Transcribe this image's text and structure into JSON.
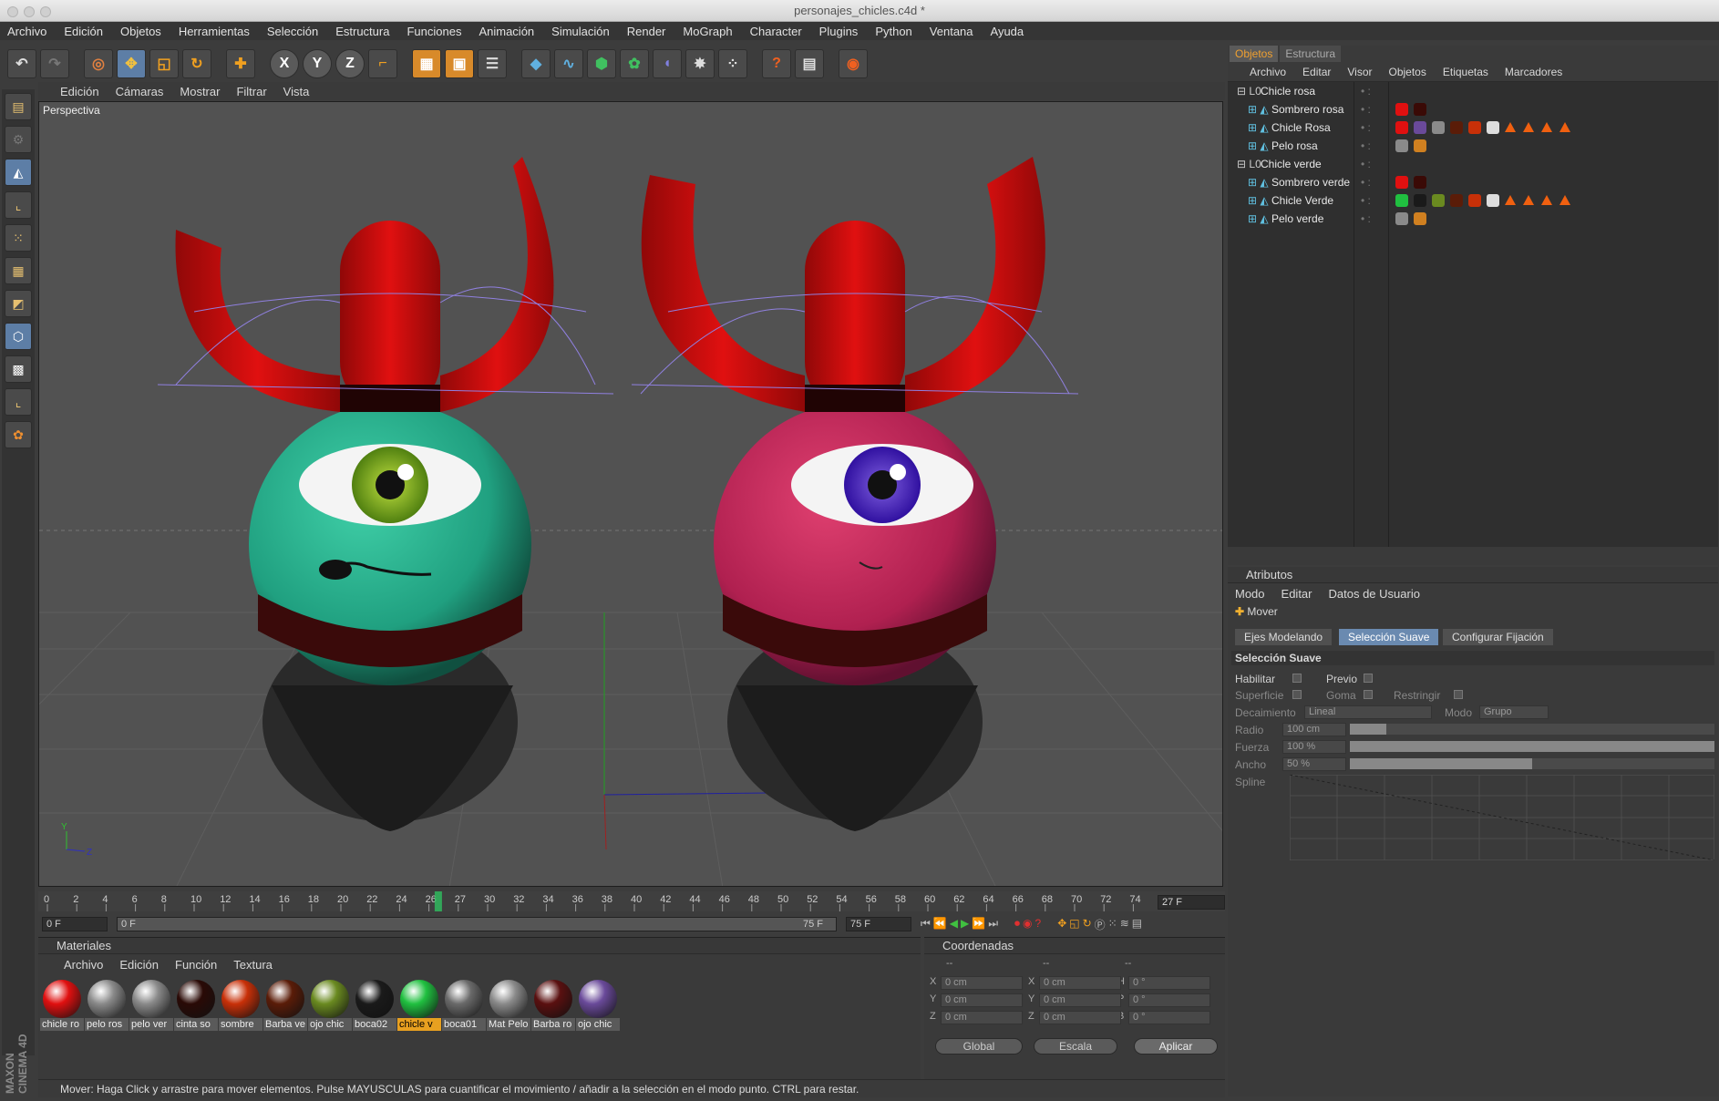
{
  "window": {
    "title": "personajes_chicles.c4d *"
  },
  "menu": [
    "Archivo",
    "Edición",
    "Objetos",
    "Herramientas",
    "Selección",
    "Estructura",
    "Funciones",
    "Animación",
    "Simulación",
    "Render",
    "MoGraph",
    "Character",
    "Plugins",
    "Python",
    "Ventana",
    "Ayuda"
  ],
  "toolbar": {
    "x_label": "X",
    "y_label": "Y",
    "z_label": "Z"
  },
  "viewport": {
    "menu": [
      "Edición",
      "Cámaras",
      "Mostrar",
      "Filtrar",
      "Vista"
    ],
    "label": "Perspectiva",
    "axis_y": "Y",
    "axis_z": "Z"
  },
  "timeline": {
    "ticks": [
      "0",
      "2",
      "4",
      "6",
      "8",
      "10",
      "12",
      "14",
      "16",
      "18",
      "20",
      "22",
      "24",
      "26",
      "27",
      "30",
      "32",
      "34",
      "36",
      "38",
      "40",
      "42",
      "44",
      "46",
      "48",
      "50",
      "52",
      "54",
      "56",
      "58",
      "60",
      "62",
      "64",
      "66",
      "68",
      "70",
      "72",
      "74"
    ],
    "current_frame": "27 F",
    "start_field": "0 F",
    "range_start": "0 F",
    "range_end": "75 F",
    "end_field": "75 F",
    "playhead_fraction": 0.36
  },
  "materials": {
    "title": "Materiales",
    "menu": [
      "Archivo",
      "Edición",
      "Función",
      "Textura"
    ],
    "items": [
      {
        "name": "chicle ro",
        "color": "#e01010"
      },
      {
        "name": "pelo ros",
        "color": "#8a8a8a"
      },
      {
        "name": "pelo ver",
        "color": "#8a8a8a"
      },
      {
        "name": "cinta so",
        "color": "#2a0a06"
      },
      {
        "name": "sombre",
        "color": "#c83008"
      },
      {
        "name": "Barba ve",
        "color": "#5a1c08"
      },
      {
        "name": "ojo chic",
        "color": "#6a8a20"
      },
      {
        "name": "boca02",
        "color": "#1a1a1a"
      },
      {
        "name": "chicle v",
        "color": "#20c040"
      },
      {
        "name": "boca01",
        "color": "#6a6a6a"
      },
      {
        "name": "Mat Pelo",
        "color": "#8a8a8a"
      },
      {
        "name": "Barba ro",
        "color": "#5a1010"
      },
      {
        "name": "ojo chic",
        "color": "#6a4a9a"
      }
    ],
    "active_index": 8
  },
  "coordinates": {
    "title": "Coordenadas",
    "headers": [
      "--",
      "--",
      "--"
    ],
    "rows": [
      {
        "l1": "X",
        "v1": "0 cm",
        "l2": "X",
        "v2": "0 cm",
        "l3": "H",
        "v3": "0 °"
      },
      {
        "l1": "Y",
        "v1": "0 cm",
        "l2": "Y",
        "v2": "0 cm",
        "l3": "P",
        "v3": "0 °"
      },
      {
        "l1": "Z",
        "v1": "0 cm",
        "l2": "Z",
        "v2": "0 cm",
        "l3": "B",
        "v3": "0 °"
      }
    ],
    "mode1": "Global",
    "mode2": "Escala",
    "apply": "Aplicar"
  },
  "status": "Mover: Haga Click y arrastre para mover elementos. Pulse MAYUSCULAS para cuantificar el movimiento / añadir a la selección en el modo punto. CTRL para restar.",
  "objects": {
    "tabs": [
      "Objetos",
      "Estructura"
    ],
    "menu": [
      "Archivo",
      "Editar",
      "Visor",
      "Objetos",
      "Etiquetas",
      "Marcadores"
    ],
    "rows": [
      {
        "name": "Chicle rosa",
        "indent": 0,
        "tags": []
      },
      {
        "name": "Sombrero rosa",
        "indent": 1,
        "tags": [
          "#e01010",
          "#3a0a06"
        ]
      },
      {
        "name": "Chicle Rosa",
        "indent": 1,
        "tags": [
          "#e01010",
          "#6a4a9a",
          "#8a8a8a",
          "#5a1c08",
          "#c83008",
          "#dddddd"
        ],
        "tris": 4
      },
      {
        "name": "Pelo rosa",
        "indent": 1,
        "tags": [
          "#8a8a8a",
          "#d08020"
        ]
      },
      {
        "name": "Chicle verde",
        "indent": 0,
        "tags": []
      },
      {
        "name": "Sombrero verde",
        "indent": 1,
        "tags": [
          "#e01010",
          "#3a0a06"
        ]
      },
      {
        "name": "Chicle Verde",
        "indent": 1,
        "tags": [
          "#20c040",
          "#1a1a1a",
          "#6a8a20",
          "#5a1c08",
          "#c83008",
          "#dddddd"
        ],
        "tris": 4
      },
      {
        "name": "Pelo verde",
        "indent": 1,
        "tags": [
          "#8a8a8a",
          "#d08020"
        ]
      }
    ]
  },
  "attributes": {
    "title": "Atributos",
    "menu": [
      "Modo",
      "Editar",
      "Datos de Usuario"
    ],
    "tool": "Mover",
    "tabs": [
      "Ejes Modelando",
      "Selección Suave",
      "Configurar Fijación"
    ],
    "active_tab": 1,
    "section": "Selección Suave",
    "habilitar": "Habilitar",
    "previo": "Previo",
    "superficie": "Superficie",
    "goma": "Goma",
    "restringir": "Restringir",
    "decaimiento": "Decaimiento",
    "decaimiento_val": "Lineal",
    "modo": "Modo",
    "modo_val": "Grupo",
    "radio": "Radio",
    "radio_val": "100 cm",
    "radio_fraction": 0.1,
    "fuerza": "Fuerza",
    "fuerza_val": "100 %",
    "fuerza_fraction": 1.0,
    "ancho": "Ancho",
    "ancho_val": "50 %",
    "ancho_fraction": 0.5,
    "spline": "Spline"
  },
  "logo": "MAXON CINEMA 4D"
}
